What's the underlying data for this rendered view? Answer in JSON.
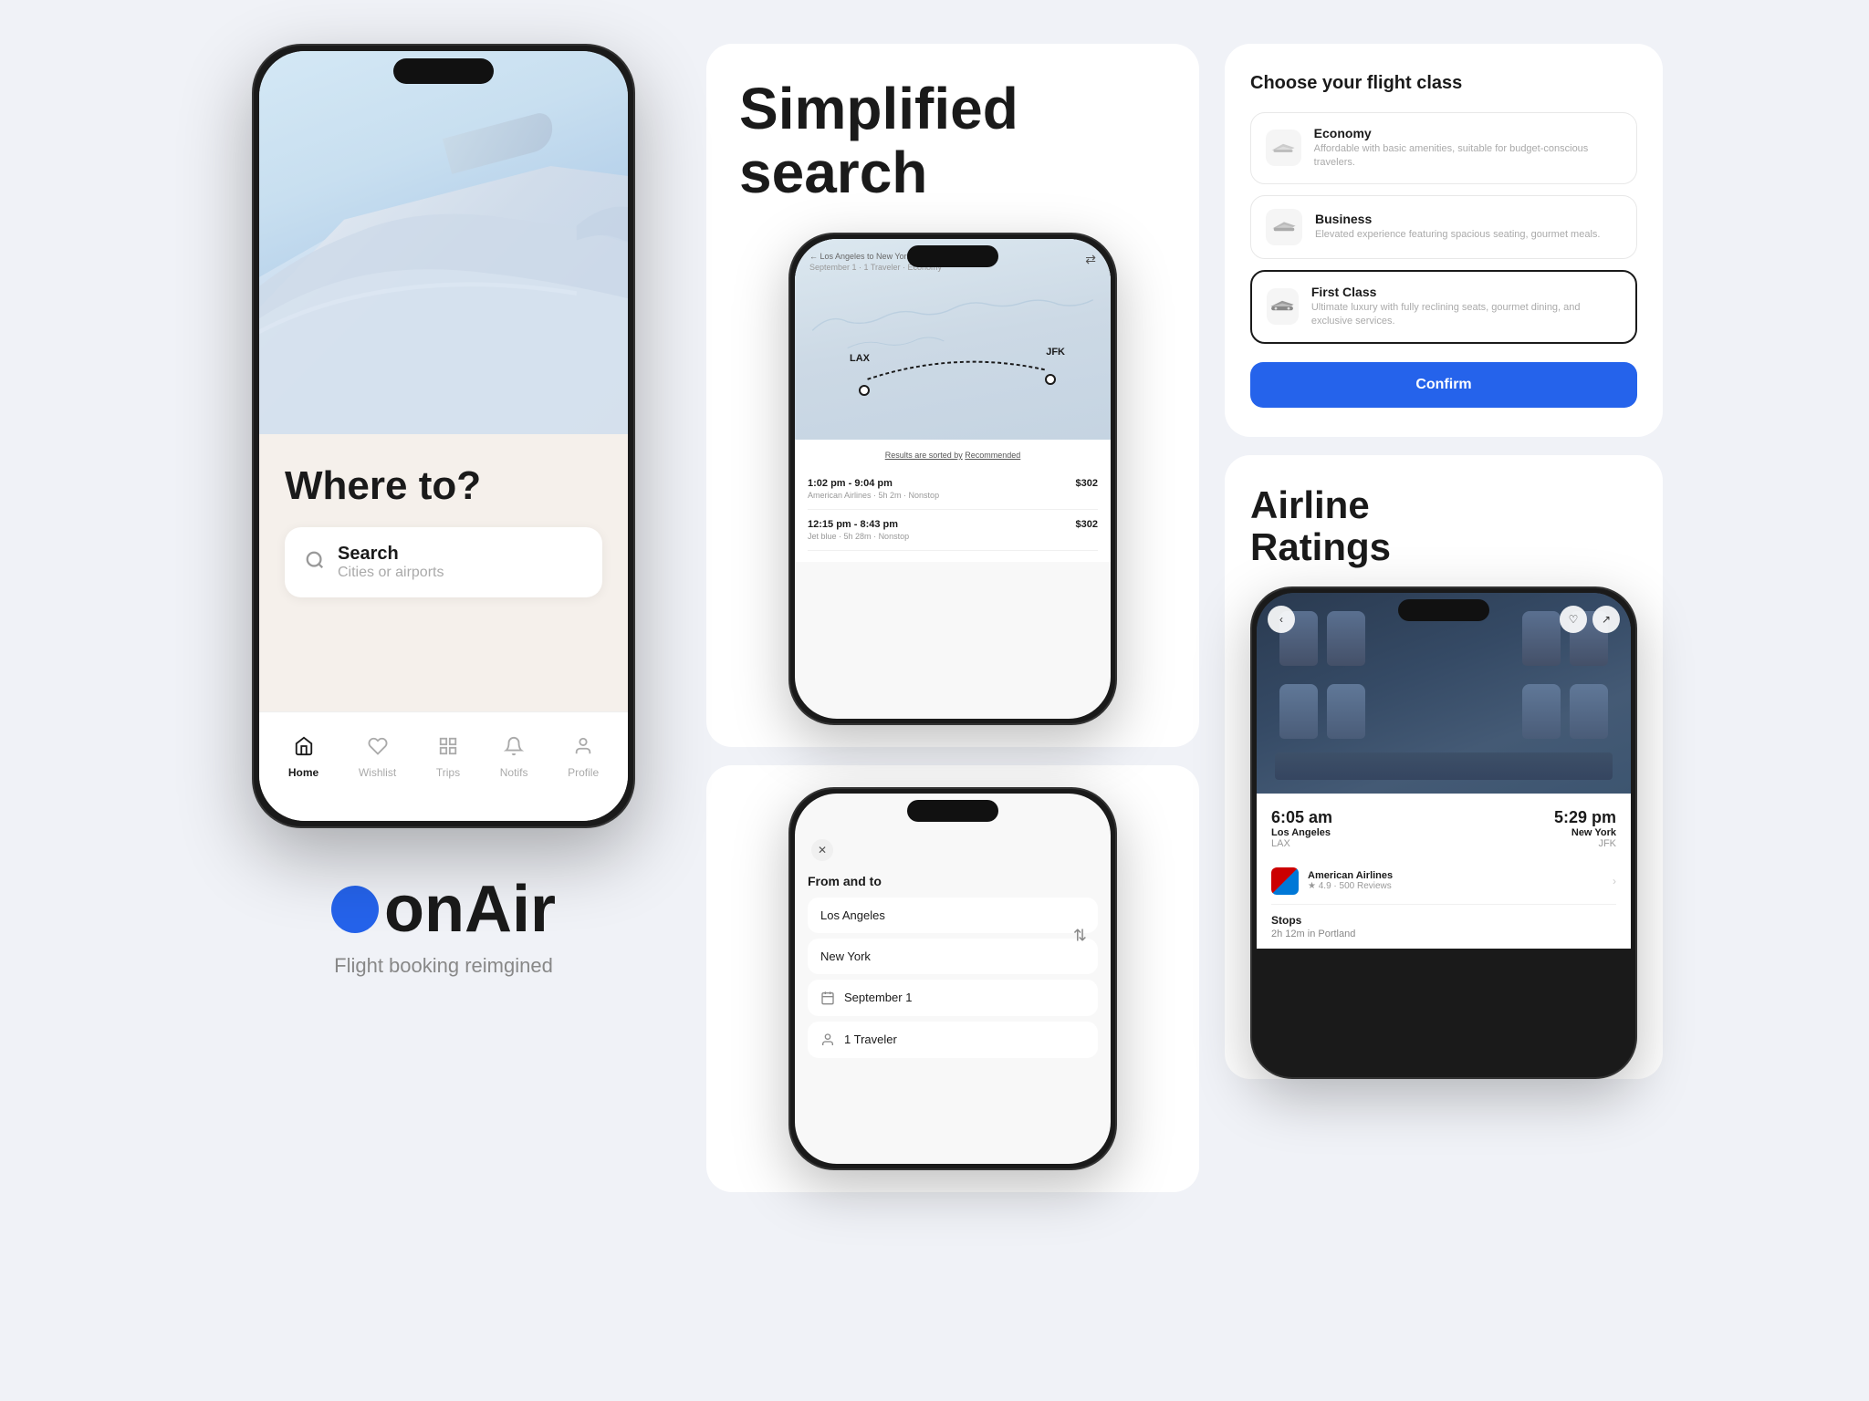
{
  "brand": {
    "name": "onAir",
    "tagline": "Flight booking reimgined",
    "dot_color": "#2563eb"
  },
  "phone1": {
    "headline": "Where to?",
    "search_label": "Search",
    "search_placeholder": "Cities or airports",
    "tabs": [
      {
        "label": "Home",
        "icon": "⌂",
        "active": true
      },
      {
        "label": "Wishlist",
        "icon": "♡",
        "active": false
      },
      {
        "label": "Trips",
        "icon": "⊞",
        "active": false
      },
      {
        "label": "Notifs",
        "icon": "🔔",
        "active": false
      },
      {
        "label": "Profile",
        "icon": "◎",
        "active": false
      }
    ]
  },
  "search_section": {
    "title_line1": "Simplified",
    "title_line2": "search"
  },
  "flight_results_phone": {
    "route_title": "Los Angeles to New York",
    "route_subtitle": "September 1 · 1 Traveler · Economy",
    "lax_label": "LAX",
    "jfk_label": "JFK",
    "sorted_text": "Results are sorted by",
    "sorted_by": "Recommended",
    "flights": [
      {
        "time": "1:02 pm - 9:04 pm",
        "price": "$302",
        "airline": "American Airlines",
        "duration": "5h 2m",
        "stops": "Nonstop"
      },
      {
        "time": "12:15 pm - 8:43 pm",
        "price": "$302",
        "airline": "Jet blue",
        "duration": "5h 28m",
        "stops": "Nonstop"
      }
    ]
  },
  "booking_phone": {
    "form_title": "From and to",
    "from_city": "Los Angeles",
    "to_city": "New York",
    "date_label": "September 1",
    "travelers_label": "1 Traveler"
  },
  "flight_class": {
    "title": "Choose your flight class",
    "options": [
      {
        "name": "Economy",
        "desc": "Affordable with basic amenities, suitable for budget-conscious travelers.",
        "selected": false
      },
      {
        "name": "Business",
        "desc": "Elevated experience featuring spacious seating, gourmet meals.",
        "selected": false
      },
      {
        "name": "First Class",
        "desc": "Ultimate luxury with fully reclining seats, gourmet dining, and exclusive services.",
        "selected": true
      }
    ],
    "confirm_label": "Confirm"
  },
  "airline_ratings": {
    "title_line1": "Airline",
    "title_line2": "Ratings"
  },
  "seat_phone": {
    "depart_time": "6:05 am",
    "arrive_time": "5:29 pm",
    "from_city": "Los Angeles",
    "from_iata": "LAX",
    "to_city": "New York",
    "to_iata": "JFK",
    "airline_name": "American Airlines",
    "airline_rating": "★ 4.9 · 500 Reviews",
    "stops_title": "Stops",
    "stops_detail": "2h 12m in Portland"
  }
}
